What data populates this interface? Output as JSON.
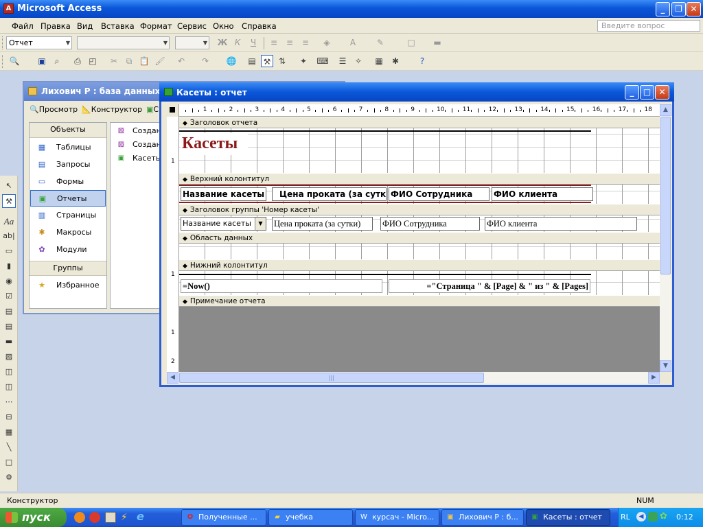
{
  "app": {
    "title": "Microsoft Access"
  },
  "menu": [
    "Файл",
    "Правка",
    "Вид",
    "Вставка",
    "Формат",
    "Сервис",
    "Окно",
    "Справка"
  ],
  "ask_placeholder": "Введите вопрос",
  "toolbar1": {
    "object_combo": "Отчет"
  },
  "db_window": {
    "title": "Лихович Р : база данных (ф",
    "toolbar": {
      "preview": "Просмотр",
      "design": "Конструктор",
      "create": "С"
    },
    "objects_header": "Объекты",
    "objects": [
      "Таблицы",
      "Запросы",
      "Формы",
      "Отчеты",
      "Страницы",
      "Макросы",
      "Модули"
    ],
    "selected_object": "Отчеты",
    "groups_header": "Группы",
    "groups": [
      "Избранное"
    ],
    "list": [
      "Создан",
      "Создан",
      "Касеть"
    ]
  },
  "report_window": {
    "title": "Касеты : отчет",
    "ruler_marks": [
      "1",
      "2",
      "3",
      "4",
      "5",
      "6",
      "7",
      "8",
      "9",
      "10",
      "11",
      "12",
      "13",
      "14",
      "15",
      "16",
      "17",
      "18"
    ],
    "vruler_marks": [
      "1",
      "1",
      "1",
      "2"
    ],
    "sections": {
      "report_header": "Заголовок отчета",
      "page_header": "Верхний колонтитул",
      "group_header": "Заголовок группы 'Номер касеты'",
      "detail": "Область данных",
      "page_footer": "Нижний колонтитул",
      "report_footer": "Примечание отчета"
    },
    "report_title": "Касеты",
    "page_header_labels": [
      "Название касеты",
      "Цена проката (за сутки)",
      "ФИО Сотрудника",
      "ФИО клиента"
    ],
    "group_fields": [
      "Название касеты",
      "Цена проката (за сутки)",
      "ФИО Сотрудника",
      "ФИО клиента"
    ],
    "footer_now": "=Now()",
    "footer_pages": "=\"Страница \" & [Page] & \" из \" & [Pages]"
  },
  "status": {
    "left": "Конструктор",
    "right": "NUM"
  },
  "taskbar": {
    "start": "пуск",
    "tasks": [
      "Полученные ...",
      "учебка",
      "курсач - Micro...",
      "Лихович Р : б...",
      "Касеты : отчет"
    ],
    "active_task": "Касеты : отчет",
    "lang": "RL",
    "clock": "0:12"
  }
}
